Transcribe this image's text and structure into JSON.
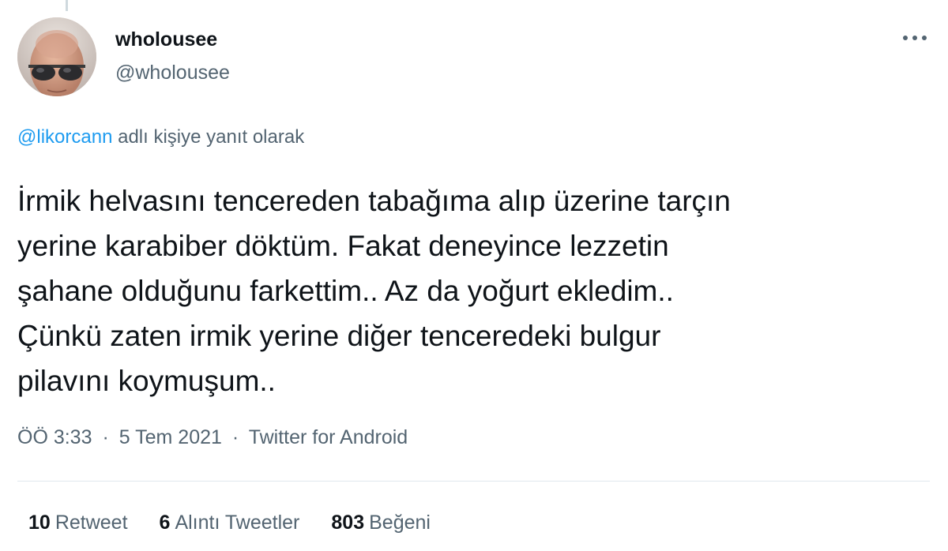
{
  "tweet": {
    "author": {
      "display_name": "wholousee",
      "handle": "@wholousee",
      "avatar_icon": "avatar-sunglasses-photo"
    },
    "more_icon": "more-horizontal-icon",
    "reply_context": {
      "mention": "@likorcann",
      "text": "adlı kişiye yanıt olarak"
    },
    "text_lines": [
      "İrmik helvasını tencereden tabağıma alıp üzerine tarçın",
      "yerine karabiber döktüm. Fakat deneyince lezzetin",
      "şahane olduğunu farkettim.. Az da yoğurt ekledim..",
      "Çünkü zaten irmik yerine diğer tenceredeki bulgur",
      "pilavını koymuşum.."
    ],
    "meta": {
      "time": "ÖÖ 3:33",
      "separator": "·",
      "date": "5 Tem 2021",
      "source": "Twitter for Android"
    },
    "stats": {
      "retweets": {
        "count": "10",
        "label": "Retweet"
      },
      "quotes": {
        "count": "6",
        "label": "Alıntı Tweetler"
      },
      "likes": {
        "count": "803",
        "label": "Beğeni"
      }
    },
    "colors": {
      "text_primary": "#0f1419",
      "text_secondary": "#536471",
      "mention": "#1d9bf0",
      "divider": "#e1e8ed"
    }
  }
}
